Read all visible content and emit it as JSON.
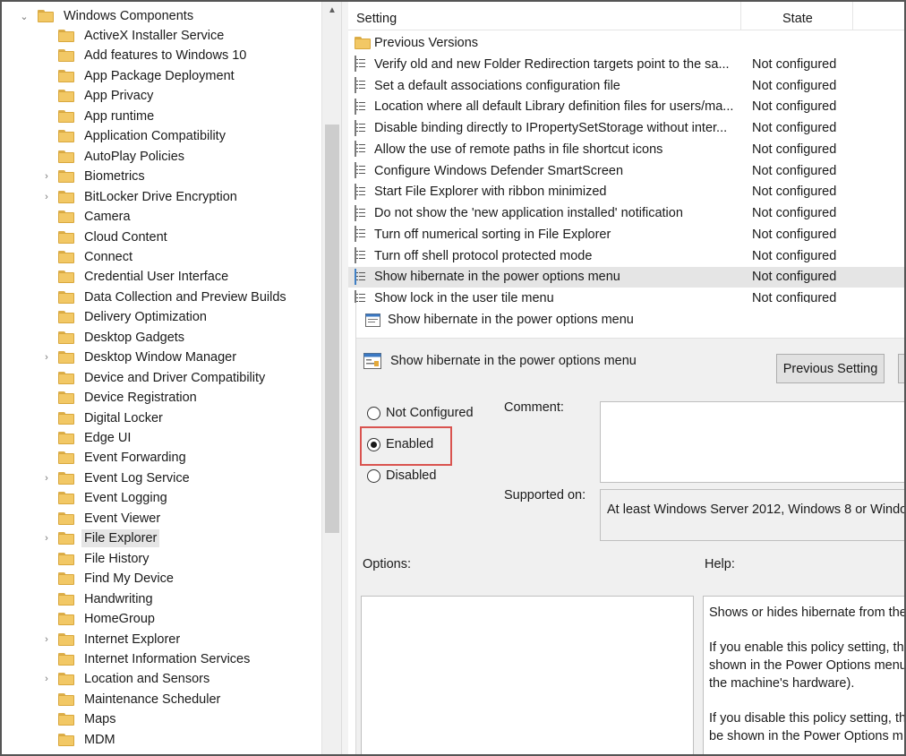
{
  "tree": {
    "parent": "Windows Components",
    "items": [
      {
        "label": "ActiveX Installer Service",
        "expandable": false
      },
      {
        "label": "Add features to Windows 10",
        "expandable": false
      },
      {
        "label": "App Package Deployment",
        "expandable": false
      },
      {
        "label": "App Privacy",
        "expandable": false
      },
      {
        "label": "App runtime",
        "expandable": false
      },
      {
        "label": "Application Compatibility",
        "expandable": false
      },
      {
        "label": "AutoPlay Policies",
        "expandable": false
      },
      {
        "label": "Biometrics",
        "expandable": true
      },
      {
        "label": "BitLocker Drive Encryption",
        "expandable": true
      },
      {
        "label": "Camera",
        "expandable": false
      },
      {
        "label": "Cloud Content",
        "expandable": false
      },
      {
        "label": "Connect",
        "expandable": false
      },
      {
        "label": "Credential User Interface",
        "expandable": false
      },
      {
        "label": "Data Collection and Preview Builds",
        "expandable": false
      },
      {
        "label": "Delivery Optimization",
        "expandable": false
      },
      {
        "label": "Desktop Gadgets",
        "expandable": false
      },
      {
        "label": "Desktop Window Manager",
        "expandable": true
      },
      {
        "label": "Device and Driver Compatibility",
        "expandable": false
      },
      {
        "label": "Device Registration",
        "expandable": false
      },
      {
        "label": "Digital Locker",
        "expandable": false
      },
      {
        "label": "Edge UI",
        "expandable": false
      },
      {
        "label": "Event Forwarding",
        "expandable": false
      },
      {
        "label": "Event Log Service",
        "expandable": true
      },
      {
        "label": "Event Logging",
        "expandable": false
      },
      {
        "label": "Event Viewer",
        "expandable": false
      },
      {
        "label": "File Explorer",
        "expandable": true,
        "selected": true
      },
      {
        "label": "File History",
        "expandable": false
      },
      {
        "label": "Find My Device",
        "expandable": false
      },
      {
        "label": "Handwriting",
        "expandable": false
      },
      {
        "label": "HomeGroup",
        "expandable": false
      },
      {
        "label": "Internet Explorer",
        "expandable": true
      },
      {
        "label": "Internet Information Services",
        "expandable": false
      },
      {
        "label": "Location and Sensors",
        "expandable": true
      },
      {
        "label": "Maintenance Scheduler",
        "expandable": false
      },
      {
        "label": "Maps",
        "expandable": false
      },
      {
        "label": "MDM",
        "expandable": false
      }
    ]
  },
  "list": {
    "col_setting": "Setting",
    "col_state": "State",
    "folder_row": "Previous Versions",
    "rows": [
      {
        "name": "Verify old and new Folder Redirection targets point to the sa...",
        "state": "Not configured"
      },
      {
        "name": "Set a default associations configuration file",
        "state": "Not configured"
      },
      {
        "name": "Location where all default Library definition files for users/ma...",
        "state": "Not configured"
      },
      {
        "name": "Disable binding directly to IPropertySetStorage without inter...",
        "state": "Not configured"
      },
      {
        "name": "Allow the use of remote paths in file shortcut icons",
        "state": "Not configured"
      },
      {
        "name": "Configure Windows Defender SmartScreen",
        "state": "Not configured"
      },
      {
        "name": "Start File Explorer with ribbon minimized",
        "state": "Not configured"
      },
      {
        "name": "Do not show the 'new application installed' notification",
        "state": "Not configured"
      },
      {
        "name": "Turn off numerical sorting in File Explorer",
        "state": "Not configured"
      },
      {
        "name": "Turn off shell protocol protected mode",
        "state": "Not configured"
      },
      {
        "name": "Show hibernate in the power options menu",
        "state": "Not configured",
        "selected": true
      },
      {
        "name": "Show lock in the user tile menu",
        "state": "Not configured"
      }
    ]
  },
  "dialog": {
    "title": "Show hibernate in the power options menu",
    "policy_name": "Show hibernate in the power options menu",
    "prev_button": "Previous Setting",
    "radio_not_configured": "Not Configured",
    "radio_enabled": "Enabled",
    "radio_disabled": "Disabled",
    "comment_label": "Comment:",
    "supported_label": "Supported on:",
    "supported_text": "At least Windows Server 2012, Windows 8 or Windo",
    "options_label": "Options:",
    "help_label": "Help:",
    "help_p1": "Shows or hides hibernate from the",
    "help_p2a": "If you enable this policy setting, th",
    "help_p2b": "shown in the Power Options menu",
    "help_p2c": "the machine's hardware).",
    "help_p3a": "If you disable this policy setting, th",
    "help_p3b": "be shown in the Power Options m"
  }
}
